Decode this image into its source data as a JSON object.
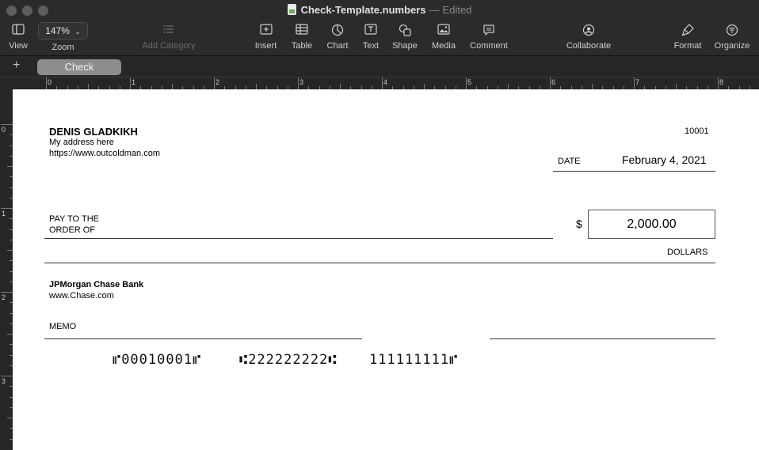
{
  "window": {
    "title": "Check-Template.numbers",
    "separator": "—",
    "status": "Edited"
  },
  "toolbar": {
    "view": {
      "label": "View",
      "icon": "sidebar-icon"
    },
    "zoom": {
      "label": "Zoom",
      "value": "147%"
    },
    "add_category": {
      "label": "Add Category",
      "icon": "list-icon"
    },
    "insert": {
      "label": "Insert",
      "icon": "insert-icon"
    },
    "table": {
      "label": "Table",
      "icon": "table-icon"
    },
    "chart": {
      "label": "Chart",
      "icon": "chart-icon"
    },
    "text": {
      "label": "Text",
      "icon": "text-icon"
    },
    "shape": {
      "label": "Shape",
      "icon": "shape-icon"
    },
    "media": {
      "label": "Media",
      "icon": "media-icon"
    },
    "comment": {
      "label": "Comment",
      "icon": "comment-icon"
    },
    "collaborate": {
      "label": "Collaborate",
      "icon": "collaborate-icon"
    },
    "format": {
      "label": "Format",
      "icon": "format-brush-icon"
    },
    "organize": {
      "label": "Organize",
      "icon": "organize-icon"
    }
  },
  "sheets": {
    "add": "+",
    "tabs": [
      {
        "label": "Check"
      }
    ]
  },
  "ruler": {
    "top": [
      "0",
      "1",
      "2",
      "3",
      "4",
      "5",
      "6",
      "7",
      "8"
    ],
    "left": [
      "0",
      "1",
      "2",
      "3"
    ]
  },
  "check": {
    "payer_name": "DENIS GLADKIKH",
    "payer_address": "My address here",
    "payer_website": "https://www.outcoldman.com",
    "check_number": "10001",
    "date_label": "DATE",
    "date_value": "February 4, 2021",
    "pay_to_line1": "PAY TO THE",
    "pay_to_line2": "ORDER OF",
    "currency_symbol": "$",
    "amount": "2,000.00",
    "dollars_label": "DOLLARS",
    "bank_name": "JPMorgan Chase Bank",
    "bank_website": "www.Chase.com",
    "memo_label": "MEMO",
    "micr_check": "⑈00010001⑈",
    "micr_routing": "⑆222222222⑆",
    "micr_account": "111111111⑈"
  },
  "colors": {
    "toolbar_bg": "#2b2a2c",
    "canvas_bg": "#ffffff",
    "sheet_tab_bg": "#8d8d8f",
    "numbers_green": "#5fb548"
  }
}
